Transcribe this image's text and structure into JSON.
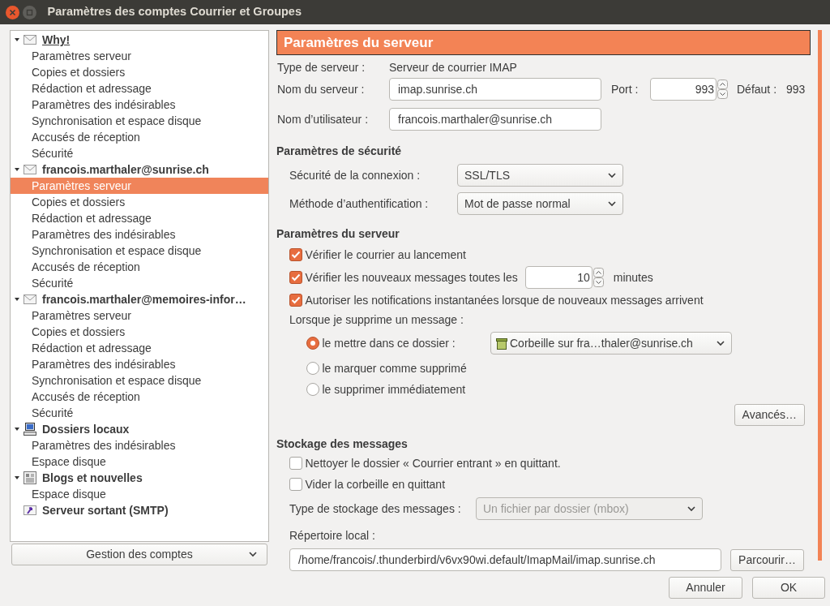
{
  "window": {
    "title": "Paramètres des comptes Courrier et Groupes"
  },
  "sidebar": {
    "accounts": [
      {
        "name": "Why!",
        "kind": "mail",
        "expanded": true,
        "is_default": true,
        "selected": false,
        "children": [
          {
            "label": "Paramètres serveur",
            "selected": false
          },
          {
            "label": "Copies et dossiers",
            "selected": false
          },
          {
            "label": "Rédaction et adressage",
            "selected": false
          },
          {
            "label": "Paramètres des indésirables",
            "selected": false
          },
          {
            "label": "Synchronisation et espace disque",
            "selected": false
          },
          {
            "label": "Accusés de réception",
            "selected": false
          },
          {
            "label": "Sécurité",
            "selected": false
          }
        ]
      },
      {
        "name": "francois.marthaler@sunrise.ch",
        "kind": "mail",
        "expanded": true,
        "is_default": false,
        "selected": false,
        "children": [
          {
            "label": "Paramètres serveur",
            "selected": true
          },
          {
            "label": "Copies et dossiers",
            "selected": false
          },
          {
            "label": "Rédaction et adressage",
            "selected": false
          },
          {
            "label": "Paramètres des indésirables",
            "selected": false
          },
          {
            "label": "Synchronisation et espace disque",
            "selected": false
          },
          {
            "label": "Accusés de réception",
            "selected": false
          },
          {
            "label": "Sécurité",
            "selected": false
          }
        ]
      },
      {
        "name": "francois.marthaler@memoires-infor…",
        "kind": "mail",
        "expanded": true,
        "is_default": false,
        "selected": false,
        "children": [
          {
            "label": "Paramètres serveur",
            "selected": false
          },
          {
            "label": "Copies et dossiers",
            "selected": false
          },
          {
            "label": "Rédaction et adressage",
            "selected": false
          },
          {
            "label": "Paramètres des indésirables",
            "selected": false
          },
          {
            "label": "Synchronisation et espace disque",
            "selected": false
          },
          {
            "label": "Accusés de réception",
            "selected": false
          },
          {
            "label": "Sécurité",
            "selected": false
          }
        ]
      },
      {
        "name": "Dossiers locaux",
        "kind": "local",
        "expanded": true,
        "is_default": false,
        "selected": false,
        "children": [
          {
            "label": "Paramètres des indésirables",
            "selected": false
          },
          {
            "label": "Espace disque",
            "selected": false
          }
        ]
      },
      {
        "name": "Blogs et nouvelles",
        "kind": "feeds",
        "expanded": true,
        "is_default": false,
        "selected": false,
        "children": [
          {
            "label": "Espace disque",
            "selected": false
          }
        ]
      },
      {
        "name": "Serveur sortant (SMTP)",
        "kind": "smtp",
        "is_default": false,
        "selected": false
      }
    ],
    "manage_button": "Gestion des comptes"
  },
  "panel": {
    "header": "Paramètres du serveur",
    "server_type": {
      "label": "Type de serveur :",
      "value": "Serveur de courrier IMAP"
    },
    "server_name": {
      "label": "Nom du serveur :",
      "value": "imap.sunrise.ch"
    },
    "port": {
      "label": "Port :",
      "value": "993"
    },
    "default_port": {
      "label": "Défaut :",
      "value": "993"
    },
    "username": {
      "label": "Nom d’utilisateur :",
      "value": "francois.marthaler@sunrise.ch"
    },
    "security": {
      "heading": "Paramètres de sécurité",
      "connection": {
        "label": "Sécurité de la connexion :",
        "value": "SSL/TLS"
      },
      "auth": {
        "label": "Méthode d’authentification :",
        "value": "Mot de passe normal"
      }
    },
    "server": {
      "heading": "Paramètres du serveur",
      "checks": [
        {
          "kind": "plain",
          "label": "Vérifier le courrier au lancement",
          "checked": true
        },
        {
          "kind": "interval",
          "label": "Vérifier les nouveaux messages toutes les",
          "checked": true,
          "value": "10",
          "suffix": "minutes"
        },
        {
          "kind": "plain",
          "label": "Autoriser les notifications instantanées lorsque de nouveaux messages arrivent",
          "checked": true
        }
      ],
      "delete_label": "Lorsque je supprime un message :",
      "delete_options": [
        {
          "kind": "folder",
          "label": "le mettre dans ce dossier :",
          "selected": true,
          "folder": "Corbeille sur fra…thaler@sunrise.ch"
        },
        {
          "kind": "plain",
          "label": "le marquer comme supprimé",
          "selected": false
        },
        {
          "kind": "plain",
          "label": "le supprimer immédiatement",
          "selected": false
        }
      ],
      "advanced_button": "Avancés…"
    },
    "storage": {
      "heading": "Stockage des messages",
      "checks": [
        {
          "label": "Nettoyer le dossier « Courrier entrant » en quittant.",
          "checked": false
        },
        {
          "label": "Vider la corbeille en quittant",
          "checked": false
        }
      ],
      "storage_type": {
        "label": "Type de stockage des messages :",
        "value": "Un fichier par dossier (mbox)",
        "disabled": true
      },
      "local_dir": {
        "label": "Répertoire local :",
        "value": "/home/francois/.thunderbird/v6vx90wi.default/ImapMail/imap.sunrise.ch"
      },
      "browse_button": "Parcourir…"
    }
  },
  "footer": {
    "buttons": [
      "Annuler",
      "OK"
    ]
  }
}
